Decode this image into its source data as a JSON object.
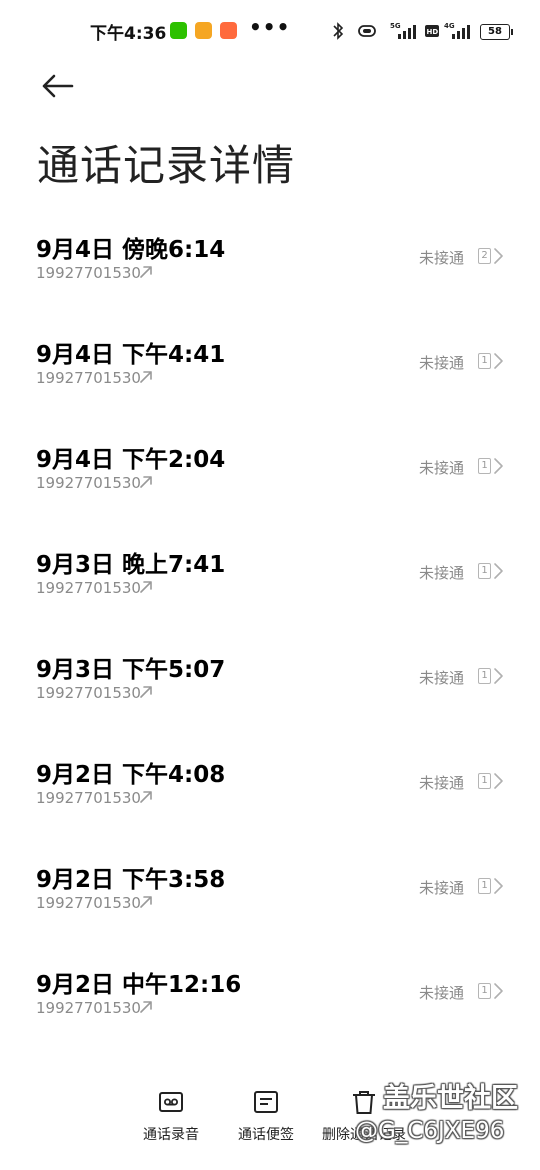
{
  "status_bar": {
    "time": "下午4:36",
    "more": "•••",
    "battery": "58"
  },
  "page": {
    "title": "通话记录详情"
  },
  "calls": [
    {
      "time": "9月4日 傍晚6:14",
      "number": "19927701530",
      "status": "未接通",
      "count": "2"
    },
    {
      "time": "9月4日 下午4:41",
      "number": "19927701530",
      "status": "未接通",
      "count": "1"
    },
    {
      "time": "9月4日 下午2:04",
      "number": "19927701530",
      "status": "未接通",
      "count": "1"
    },
    {
      "time": "9月3日 晚上7:41",
      "number": "19927701530",
      "status": "未接通",
      "count": "1"
    },
    {
      "time": "9月3日 下午5:07",
      "number": "19927701530",
      "status": "未接通",
      "count": "1"
    },
    {
      "time": "9月2日 下午4:08",
      "number": "19927701530",
      "status": "未接通",
      "count": "1"
    },
    {
      "time": "9月2日 下午3:58",
      "number": "19927701530",
      "status": "未接通",
      "count": "1"
    },
    {
      "time": "9月2日 中午12:16",
      "number": "19927701530",
      "status": "未接通",
      "count": "1"
    }
  ],
  "bottom_bar": {
    "record_label": "通话录音",
    "note_label": "通话便签",
    "delete_label": "删除通话记录"
  },
  "watermark": {
    "line1": "盖乐世社区",
    "line2": "@G_C6JXE96"
  }
}
